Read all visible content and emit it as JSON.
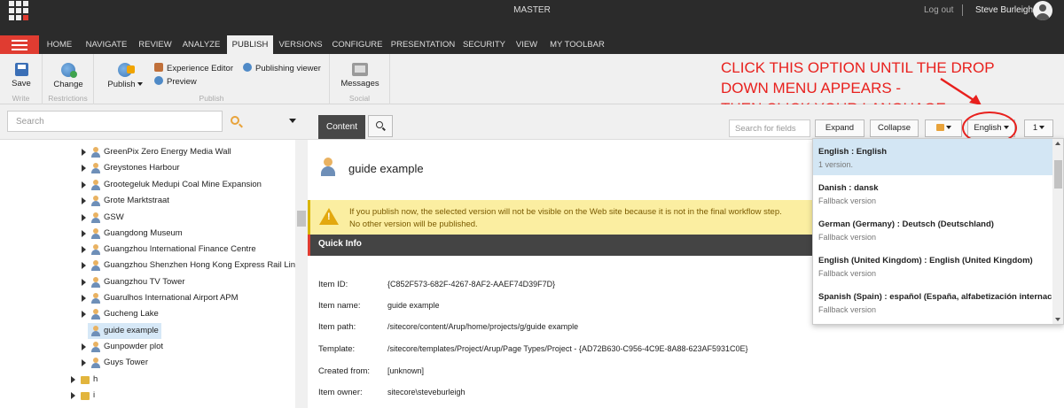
{
  "topbar": {
    "title": "MASTER",
    "logout": "Log out",
    "user_name": "Steve Burleigh"
  },
  "ribbon_tabs": [
    "HOME",
    "NAVIGATE",
    "REVIEW",
    "ANALYZE",
    "PUBLISH",
    "VERSIONS",
    "CONFIGURE",
    "PRESENTATION",
    "SECURITY",
    "VIEW",
    "MY TOOLBAR"
  ],
  "active_tab": "PUBLISH",
  "ribbon": {
    "write": {
      "label": "Write",
      "save": "Save"
    },
    "restrictions": {
      "label": "Restrictions",
      "change": "Change"
    },
    "publish": {
      "label": "Publish",
      "publish_btn": "Publish",
      "experience_editor": "Experience Editor",
      "preview": "Preview",
      "publishing_viewer": "Publishing viewer"
    },
    "social": {
      "label": "Social",
      "messages": "Messages"
    }
  },
  "annotation": {
    "line1": "CLICK THIS OPTION UNTIL THE DROP",
    "line2": "DOWN MENU APPEARS -",
    "line3": "THEN CLICK YOUR LANGUAGE",
    "color": "#e8201d"
  },
  "left_panel": {
    "search_placeholder": "Search",
    "tree_items": [
      {
        "label": "GreenPix Zero Energy Media Wall",
        "type": "item"
      },
      {
        "label": "Greystones Harbour",
        "type": "item"
      },
      {
        "label": "Grootegeluk Medupi Coal Mine Expansion",
        "type": "item"
      },
      {
        "label": "Grote Marktstraat",
        "type": "item"
      },
      {
        "label": "GSW",
        "type": "item"
      },
      {
        "label": "Guangdong Museum",
        "type": "item"
      },
      {
        "label": "Guangzhou International Finance Centre",
        "type": "item"
      },
      {
        "label": "Guangzhou Shenzhen Hong Kong Express Rail Link",
        "type": "item"
      },
      {
        "label": "Guangzhou TV Tower",
        "type": "item"
      },
      {
        "label": "Guarulhos International Airport APM",
        "type": "item"
      },
      {
        "label": "Gucheng Lake",
        "type": "item"
      },
      {
        "label": "guide example",
        "type": "item",
        "selected": true
      },
      {
        "label": "Gunpowder plot",
        "type": "item"
      },
      {
        "label": "Guys Tower",
        "type": "item"
      },
      {
        "label": "h",
        "type": "folder"
      },
      {
        "label": "i",
        "type": "folder"
      }
    ]
  },
  "toolbar": {
    "content_tab": "Content",
    "search_fields_placeholder": "Search for fields",
    "expand": "Expand",
    "collapse": "Collapse",
    "language": "English",
    "version": "1"
  },
  "item": {
    "title": "guide example",
    "warning_line1": "If you publish now, the selected version will not be visible on the Web site because it is not in the final workflow step.",
    "warning_line2": "No other version will be published.",
    "quick_info_label": "Quick Info",
    "quick_info": [
      {
        "key": "Item ID:",
        "value": "{C852F573-682F-4267-8AF2-AAEF74D39F7D}"
      },
      {
        "key": "Item name:",
        "value": "guide example"
      },
      {
        "key": "Item path:",
        "value": "/sitecore/content/Arup/home/projects/g/guide example"
      },
      {
        "key": "Template:",
        "value": "/sitecore/templates/Project/Arup/Page Types/Project - {AD72B630-C956-4C9E-8A88-623AF5931C0E}"
      },
      {
        "key": "Created from:",
        "value": "[unknown]"
      },
      {
        "key": "Item owner:",
        "value": "sitecore\\steveburleigh"
      }
    ]
  },
  "language_menu": [
    {
      "name": "English : English",
      "sub": "1 version.",
      "selected": true
    },
    {
      "name": "Danish : dansk",
      "sub": "Fallback version"
    },
    {
      "name": "German (Germany) : Deutsch (Deutschland)",
      "sub": "Fallback version"
    },
    {
      "name": "English (United Kingdom) : English (United Kingdom)",
      "sub": "Fallback version"
    },
    {
      "name": "Spanish (Spain) : español (España, alfabetización internacional)",
      "sub": "Fallback version"
    }
  ],
  "colors": {
    "accent_red": "#e03c31",
    "topbar": "#2b2b2b",
    "warning_bg": "#fbeea1",
    "selection": "#d3e6f4"
  }
}
